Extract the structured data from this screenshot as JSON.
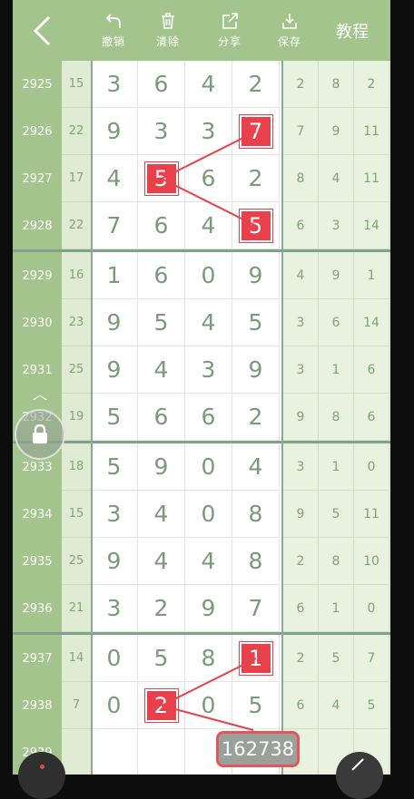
{
  "toolbar": {
    "undo": "撤销",
    "clear": "清除",
    "share": "分享",
    "save": "保存",
    "tutorial": "教程"
  },
  "rows": [
    {
      "period": "2925",
      "sum": "15",
      "digits": [
        "3",
        "6",
        "4",
        "2"
      ],
      "right": [
        "2",
        "8",
        "2"
      ]
    },
    {
      "period": "2926",
      "sum": "22",
      "digits": [
        "9",
        "3",
        "3",
        "7"
      ],
      "right": [
        "7",
        "9",
        "11"
      ]
    },
    {
      "period": "2927",
      "sum": "17",
      "digits": [
        "4",
        "5",
        "6",
        "2"
      ],
      "right": [
        "8",
        "4",
        "11"
      ]
    },
    {
      "period": "2928",
      "sum": "22",
      "digits": [
        "7",
        "6",
        "4",
        "5"
      ],
      "right": [
        "6",
        "3",
        "14"
      ]
    },
    {
      "period": "2929",
      "sum": "16",
      "digits": [
        "1",
        "6",
        "0",
        "9"
      ],
      "right": [
        "4",
        "9",
        "1"
      ]
    },
    {
      "period": "2930",
      "sum": "23",
      "digits": [
        "9",
        "5",
        "4",
        "5"
      ],
      "right": [
        "3",
        "6",
        "14"
      ]
    },
    {
      "period": "2931",
      "sum": "25",
      "digits": [
        "9",
        "4",
        "3",
        "9"
      ],
      "right": [
        "3",
        "1",
        "6"
      ]
    },
    {
      "period": "2932",
      "sum": "19",
      "digits": [
        "5",
        "6",
        "6",
        "2"
      ],
      "right": [
        "9",
        "8",
        "6"
      ]
    },
    {
      "period": "2933",
      "sum": "18",
      "digits": [
        "5",
        "9",
        "0",
        "4"
      ],
      "right": [
        "3",
        "1",
        "0"
      ]
    },
    {
      "period": "2934",
      "sum": "15",
      "digits": [
        "3",
        "4",
        "0",
        "8"
      ],
      "right": [
        "9",
        "5",
        "11"
      ]
    },
    {
      "period": "2935",
      "sum": "25",
      "digits": [
        "9",
        "4",
        "4",
        "8"
      ],
      "right": [
        "2",
        "8",
        "10"
      ]
    },
    {
      "period": "2936",
      "sum": "21",
      "digits": [
        "3",
        "2",
        "9",
        "7"
      ],
      "right": [
        "6",
        "1",
        "0"
      ]
    },
    {
      "period": "2937",
      "sum": "14",
      "digits": [
        "0",
        "5",
        "8",
        "1"
      ],
      "right": [
        "2",
        "5",
        "7"
      ]
    },
    {
      "period": "2938",
      "sum": "7",
      "digits": [
        "0",
        "2",
        "0",
        "5"
      ],
      "right": [
        "6",
        "4",
        "5"
      ]
    },
    {
      "period": "2939",
      "sum": "",
      "digits": [
        "",
        "",
        "",
        ""
      ],
      "right": [
        "",
        "",
        ""
      ]
    }
  ],
  "highlights": [
    [
      1,
      3
    ],
    [
      2,
      1
    ],
    [
      3,
      3
    ],
    [
      12,
      3
    ],
    [
      13,
      1
    ]
  ],
  "badge": {
    "count": "162738"
  },
  "colors": {
    "accent_green": "#a3c48d",
    "highlight_red": "#e8414c"
  }
}
